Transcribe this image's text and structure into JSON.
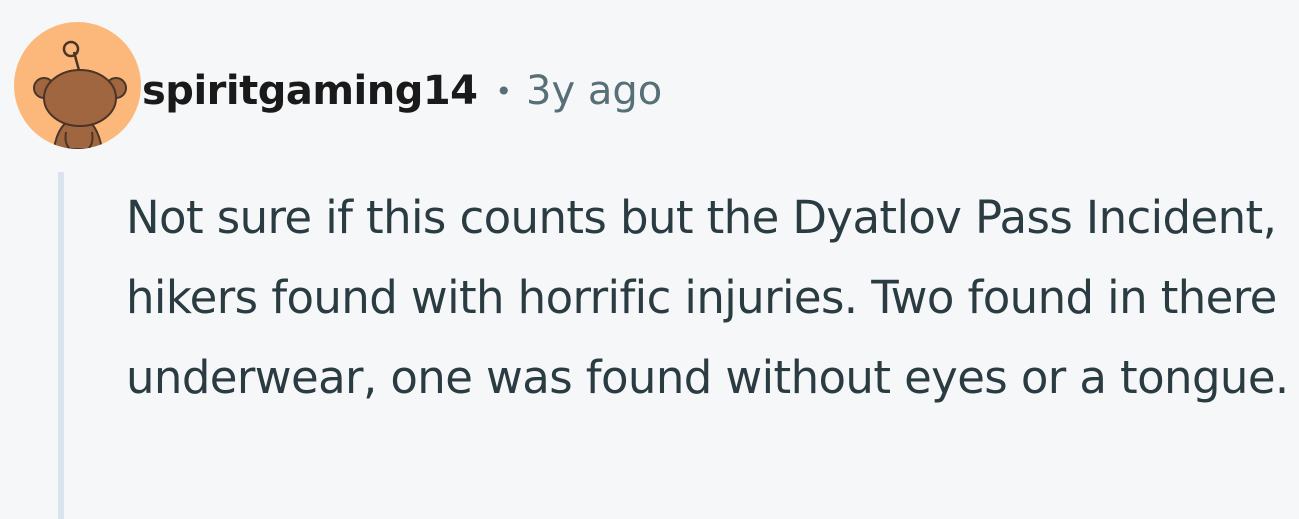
{
  "comment": {
    "author": "spiritgaming14",
    "separator": "•",
    "timestamp": "3y ago",
    "avatar_icon": "snoo-avatar-icon",
    "avatar_color": "#fbb87a",
    "body": "Not sure if this counts but the Dyatlov Pass Incident, hikers found with horrific injuries. Two found in there underwear, one was found without eyes or a tongue."
  }
}
